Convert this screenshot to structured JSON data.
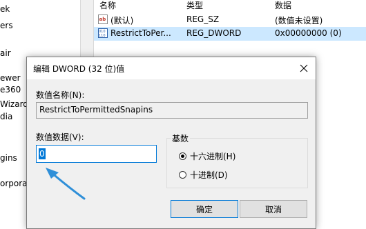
{
  "tree": {
    "items": [
      "ek",
      "ers",
      "air",
      "ewer",
      "e360",
      "Wizard",
      "dia",
      "gins",
      "orporat"
    ]
  },
  "list": {
    "columns": {
      "name": "名称",
      "type": "类型",
      "data": "数据"
    },
    "rows": [
      {
        "name": "(默认)",
        "type": "REG_SZ",
        "data": "(数值未设置)",
        "icon": "string-value-icon",
        "selected": false
      },
      {
        "name": "RestrictToPer...",
        "type": "REG_DWORD",
        "data": "0x00000000 (0)",
        "icon": "binary-value-icon",
        "selected": true
      }
    ]
  },
  "dialog": {
    "title": "编辑 DWORD (32 位)值",
    "value_name_label": "数值名称(N):",
    "value_name": "RestrictToPermittedSnapins",
    "value_data_label": "数值数据(V):",
    "value_data": "0",
    "base_label": "基数",
    "base_options": [
      {
        "label": "十六进制(H)",
        "checked": true
      },
      {
        "label": "十进制(D)",
        "checked": false
      }
    ],
    "ok_label": "确定",
    "cancel_label": "取消"
  },
  "colors": {
    "accent": "#0078d7",
    "selection": "#cce8ff",
    "arrow": "#2f8fd8"
  }
}
